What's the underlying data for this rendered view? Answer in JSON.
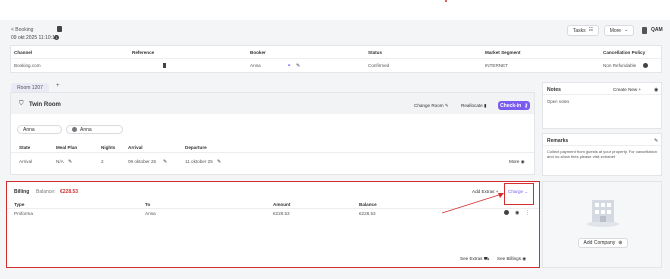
{
  "header": {
    "breadcrumb": "< Booking",
    "date": "09 okt 2025 11:10:12",
    "tasks_label": "Tasks",
    "more_label": "More",
    "user_label": "QAM"
  },
  "booking_table": {
    "headers": [
      "Channel",
      "Reference",
      "Booker",
      "Status",
      "Market Segment",
      "Cancellation Policy"
    ],
    "row": {
      "channel": "Booking.com",
      "booker": "Anna",
      "status": "Confirmed",
      "segment": "INTERNET",
      "policy": "Non Refundable"
    }
  },
  "room_tabs": {
    "active": "Room 1207",
    "add": "+"
  },
  "room": {
    "title": "Twin Room",
    "change_room": "Change Room",
    "reallocate": "Reallocate",
    "check_in": "Check-in",
    "guest1": "Anna",
    "guest2": "Anna",
    "headers": [
      "State",
      "Meal Plan",
      "Nights",
      "Arrival",
      "Departure"
    ],
    "values": {
      "state": "Arrival",
      "meal": "N/A",
      "nights": "2",
      "arrival": "09 oktober 25",
      "departure": "11 oktober 25"
    },
    "more": "More"
  },
  "billing": {
    "title": "Billing",
    "balance_label": "Balance:",
    "balance_value": "€228.53",
    "add_extras": "Add Extras",
    "charge": "Charge",
    "headers": [
      "Type",
      "To",
      "Amount",
      "Balance"
    ],
    "row": {
      "type": "Proforma",
      "to": "Anna",
      "amount": "€228.53",
      "balance": "€228.53"
    },
    "see_extras": "See Extras",
    "see_billings": "See Billings"
  },
  "notes": {
    "title": "Notes",
    "create_new": "Create New",
    "text": "Open notes"
  },
  "remarks": {
    "title": "Remarks",
    "text": "Collect payment from guests at your property. For cancellation and no-show fees please visit extranet"
  },
  "company": {
    "add_label": "Add Company"
  },
  "colors": {
    "accent": "#7b5cf0",
    "highlight": "#d32f2f",
    "balance": "#d32f2f"
  }
}
